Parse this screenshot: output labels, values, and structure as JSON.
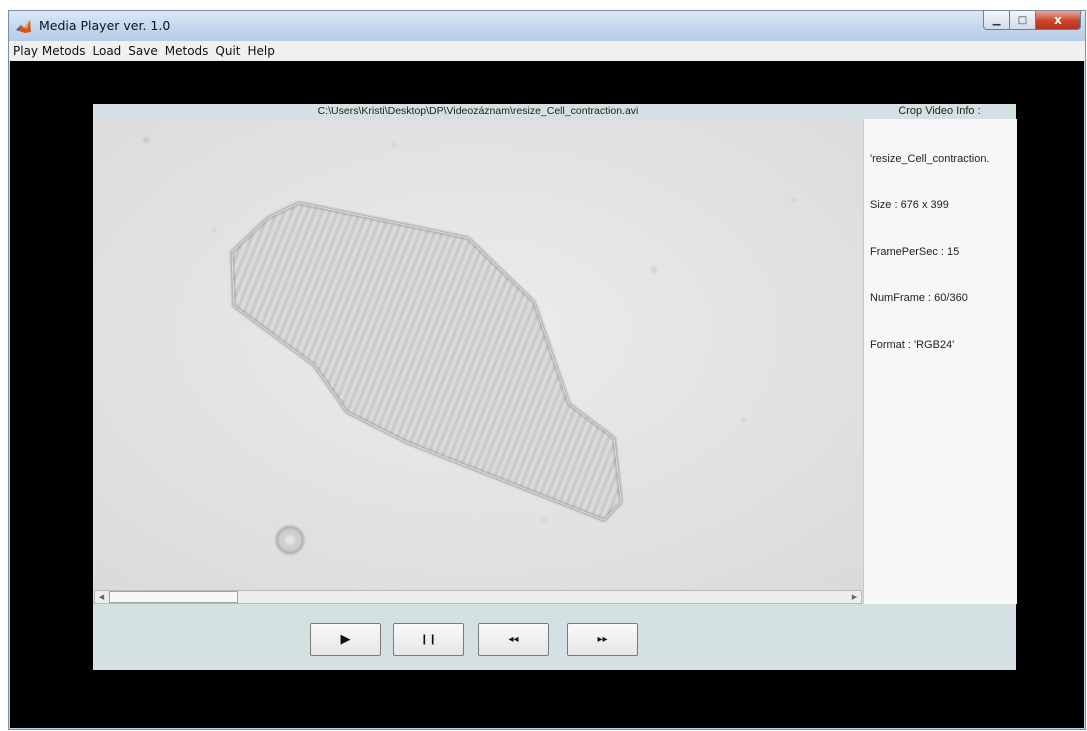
{
  "window": {
    "title": "Media Player ver. 1.0",
    "caption": {
      "minimize": "▁",
      "maximize": "□",
      "close": "x"
    }
  },
  "menu": [
    "Play Metods",
    "Load",
    "Save",
    "Metods",
    "Quit",
    "Help"
  ],
  "video": {
    "path": "C:\\Users\\Kristi\\Desktop\\DP\\Videozáznam\\resize_Cell_contraction.avi",
    "scroll_position": 0.0
  },
  "info": {
    "header": "Crop Video Info :",
    "filename": "'resize_Cell_contraction.",
    "size": "Size :  676 x 399",
    "fps": "FramePerSec  : 15",
    "num_frame": "NumFrame : 60/360",
    "format": "Format  : 'RGB24'"
  },
  "controls": {
    "play": "▶",
    "pause": "❙❙",
    "rewind": "◂◂",
    "forward": "▸▸"
  },
  "icons": {
    "app": "matlab-icon",
    "play": "play-icon",
    "pause": "pause-icon",
    "rewind": "rewind-icon",
    "forward": "fast-forward-icon"
  }
}
